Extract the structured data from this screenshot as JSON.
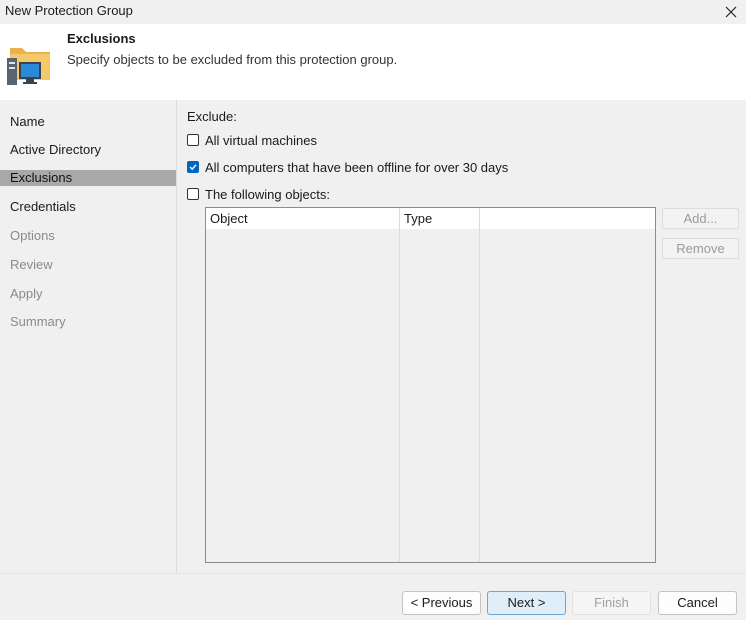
{
  "window": {
    "title": "New Protection Group",
    "close_icon": "close-icon"
  },
  "header": {
    "title": "Exclusions",
    "description": "Specify objects to be excluded from this protection group.",
    "icon": "folder-computer-icon"
  },
  "sidebar": {
    "items": [
      {
        "label": "Name",
        "state": "normal"
      },
      {
        "label": "Active Directory",
        "state": "normal"
      },
      {
        "label": "Exclusions",
        "state": "active"
      },
      {
        "label": "Credentials",
        "state": "normal"
      },
      {
        "label": "Options",
        "state": "disabled"
      },
      {
        "label": "Review",
        "state": "disabled"
      },
      {
        "label": "Apply",
        "state": "disabled"
      },
      {
        "label": "Summary",
        "state": "disabled"
      }
    ]
  },
  "main": {
    "exclude_label": "Exclude:",
    "options": [
      {
        "label": "All virtual machines",
        "checked": false
      },
      {
        "label": "All computers that have been offline for over 30 days",
        "checked": true
      },
      {
        "label": "The following objects:",
        "checked": false
      }
    ],
    "table": {
      "columns": [
        "Object",
        "Type",
        ""
      ],
      "rows": []
    },
    "add_label": "Add...",
    "remove_label": "Remove"
  },
  "footer": {
    "previous_label": "< Previous",
    "next_label": "Next >",
    "finish_label": "Finish",
    "cancel_label": "Cancel"
  },
  "colors": {
    "accent": "#0067c0",
    "active_nav": "#a8a8a8",
    "primary_button": "#e0eef9"
  }
}
